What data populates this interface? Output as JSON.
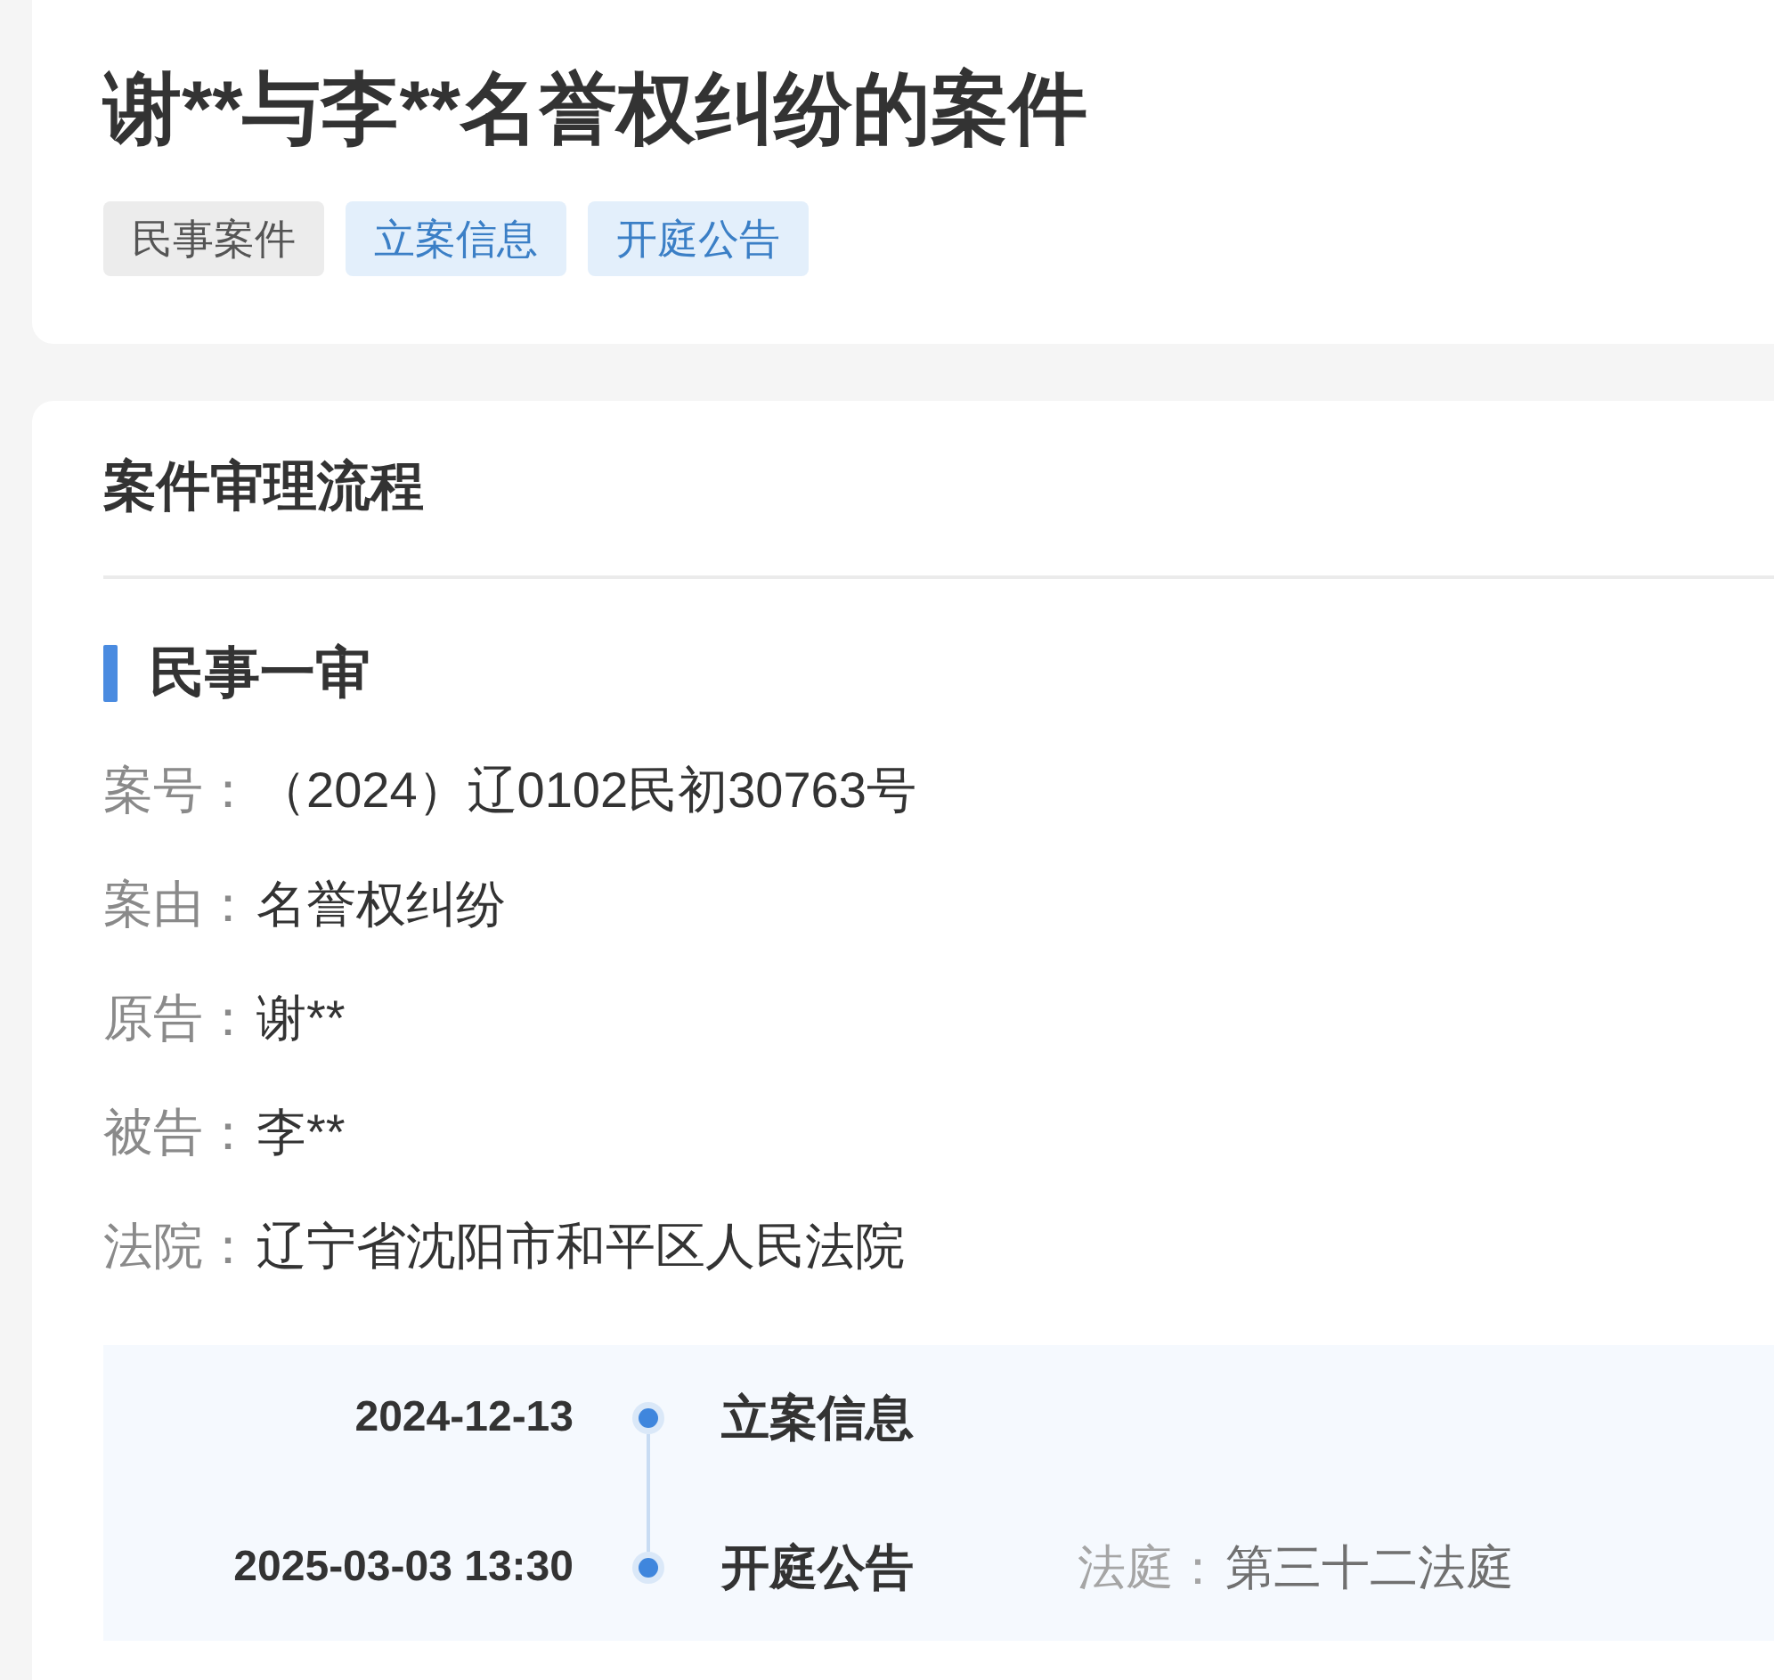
{
  "case": {
    "title": "谢**与李**名誉权纠纷的案件",
    "tags": [
      {
        "label": "民事案件",
        "kind": "category"
      },
      {
        "label": "立案信息",
        "kind": "link"
      },
      {
        "label": "开庭公告",
        "kind": "link"
      }
    ]
  },
  "process": {
    "heading": "案件审理流程",
    "stages": [
      {
        "title": "民事一审",
        "fields": [
          {
            "label": "案号：",
            "value": "（2024）辽0102民初30763号"
          },
          {
            "label": "案由：",
            "value": "名誉权纠纷"
          },
          {
            "label": "原告：",
            "value": "谢**"
          },
          {
            "label": "被告：",
            "value": "李**"
          },
          {
            "label": "法院：",
            "value": "辽宁省沈阳市和平区人民法院"
          }
        ],
        "timeline": [
          {
            "date": "2024-12-13",
            "event": "立案信息"
          },
          {
            "date": "2025-03-03 13:30",
            "event": "开庭公告",
            "details": [
              {
                "label": "法庭：",
                "value": "第三十二法庭"
              }
            ]
          }
        ]
      }
    ]
  }
}
